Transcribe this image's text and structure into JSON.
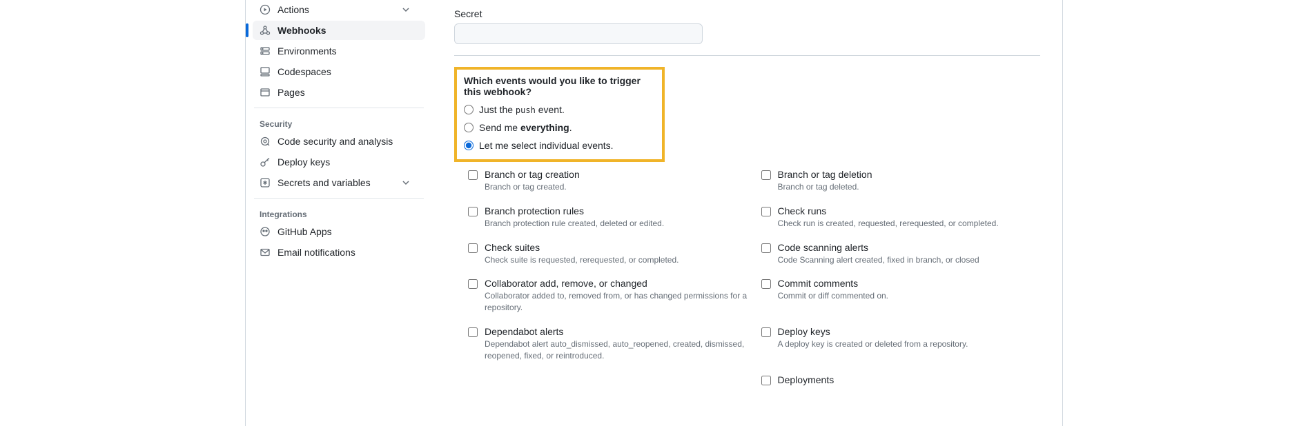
{
  "sidebar": {
    "nav_top": [
      {
        "label": "Actions",
        "icon": "play"
      },
      {
        "label": "Webhooks",
        "icon": "webhook"
      },
      {
        "label": "Environments",
        "icon": "server"
      },
      {
        "label": "Codespaces",
        "icon": "codespaces"
      },
      {
        "label": "Pages",
        "icon": "browser"
      }
    ],
    "security_title": "Security",
    "nav_security": [
      {
        "label": "Code security and analysis",
        "icon": "security"
      },
      {
        "label": "Deploy keys",
        "icon": "key"
      },
      {
        "label": "Secrets and variables",
        "icon": "asterisk"
      }
    ],
    "integrations_title": "Integrations",
    "nav_integrations": [
      {
        "label": "GitHub Apps",
        "icon": "apps"
      },
      {
        "label": "Email notifications",
        "icon": "mail"
      }
    ]
  },
  "form": {
    "secret_label": "Secret",
    "events_title": "Which events would you like to trigger this webhook?",
    "radio_push_pre": "Just the ",
    "radio_push_code": "push",
    "radio_push_post": " event.",
    "radio_everything_pre": "Send me ",
    "radio_everything_bold": "everything",
    "radio_everything_post": ".",
    "radio_individual": "Let me select individual events."
  },
  "events_left": [
    {
      "label": "Branch or tag creation",
      "desc": "Branch or tag created."
    },
    {
      "label": "Branch protection rules",
      "desc": "Branch protection rule created, deleted or edited."
    },
    {
      "label": "Check suites",
      "desc": "Check suite is requested, rerequested, or completed."
    },
    {
      "label": "Collaborator add, remove, or changed",
      "desc": "Collaborator added to, removed from, or has changed permissions for a repository."
    },
    {
      "label": "Dependabot alerts",
      "desc": "Dependabot alert auto_dismissed, auto_reopened, created, dismissed, reopened, fixed, or reintroduced."
    }
  ],
  "events_right": [
    {
      "label": "Branch or tag deletion",
      "desc": "Branch or tag deleted."
    },
    {
      "label": "Check runs",
      "desc": "Check run is created, requested, rerequested, or completed."
    },
    {
      "label": "Code scanning alerts",
      "desc": "Code Scanning alert created, fixed in branch, or closed"
    },
    {
      "label": "Commit comments",
      "desc": "Commit or diff commented on."
    },
    {
      "label": "Deploy keys",
      "desc": "A deploy key is created or deleted from a repository."
    },
    {
      "label": "Deployments",
      "desc": ""
    }
  ]
}
